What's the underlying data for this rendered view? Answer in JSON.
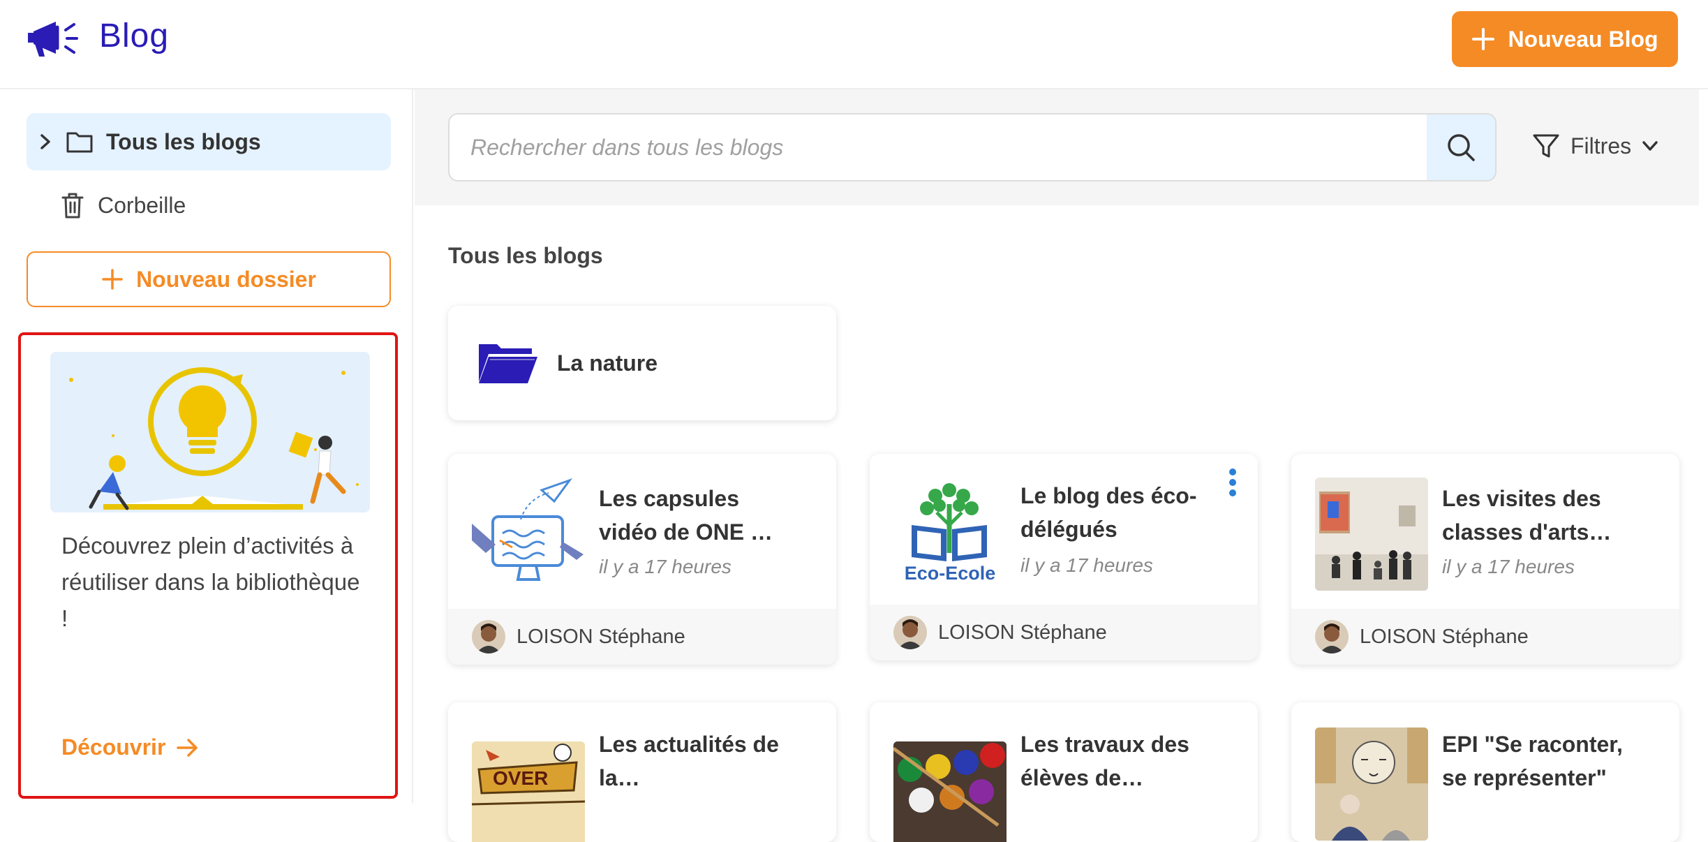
{
  "header": {
    "app_title": "Blog",
    "new_blog_label": "Nouveau Blog",
    "accent_color": "#f58b25",
    "brand_color": "#2a1cb5"
  },
  "sidebar": {
    "items": [
      {
        "label": "Tous les blogs",
        "icon": "folder-icon",
        "active": true
      },
      {
        "label": "Corbeille",
        "icon": "trash-icon",
        "active": false
      }
    ],
    "new_folder_label": "Nouveau dossier",
    "promo": {
      "text": "Découvrez plein d’activités à réutiliser dans la bibliothèque !",
      "link_label": "Découvrir"
    }
  },
  "main": {
    "search": {
      "placeholder": "Rechercher dans tous les blogs"
    },
    "filters_label": "Filtres",
    "section_title": "Tous les blogs",
    "folders": [
      {
        "name": "La nature"
      }
    ],
    "blogs": [
      {
        "title": "Les capsules vidéo de ONE …",
        "date": "il y a 17 heures",
        "author": "LOISON Stéphane"
      },
      {
        "title": "Le blog des éco-délégués",
        "date": "il y a 17 heures",
        "author": "LOISON Stéphane",
        "thumb_text": "Eco-Ecole"
      },
      {
        "title": "Les visites des classes d'arts…",
        "date": "il y a 17 heures",
        "author": "LOISON Stéphane"
      },
      {
        "title": "Les actualités de la…"
      },
      {
        "title": "Les travaux des élèves de…"
      },
      {
        "title": "EPI \"Se raconter, se représenter\""
      }
    ]
  }
}
